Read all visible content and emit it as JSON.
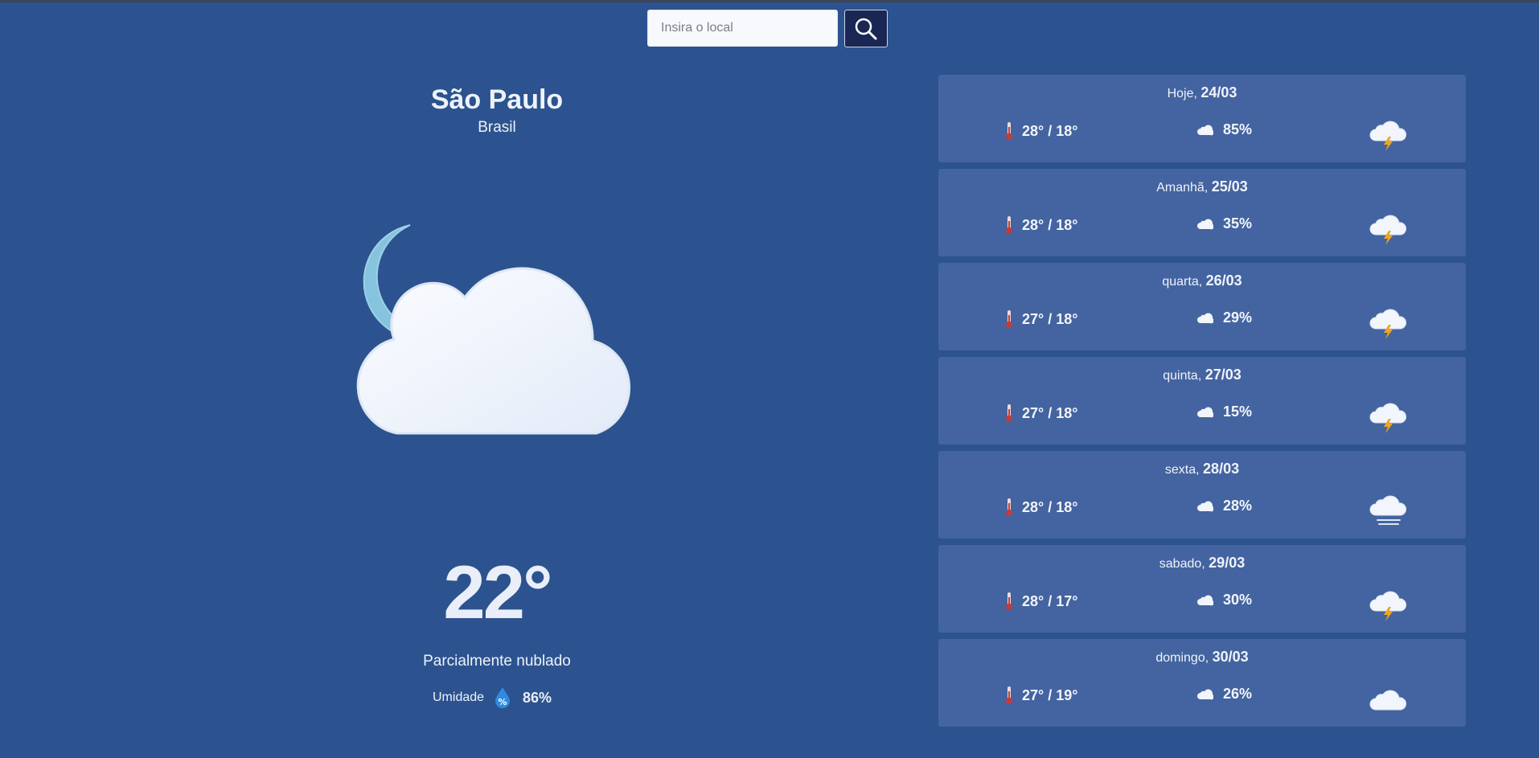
{
  "search": {
    "placeholder": "Insira o local",
    "value": "",
    "button_icon": "search-icon"
  },
  "current": {
    "city": "São Paulo",
    "country": "Brasil",
    "temperature": "22°",
    "description": "Parcialmente nublado",
    "humidity_label": "Umidade",
    "humidity_value": "86%",
    "icon": "partly-cloudy-night-icon"
  },
  "forecast": [
    {
      "label": "Hoje, ",
      "date": "24/03",
      "minmax": "28° / 18°",
      "rain": "85%",
      "icon": "thunderstorm-icon"
    },
    {
      "label": "Amanhã, ",
      "date": "25/03",
      "minmax": "28° / 18°",
      "rain": "35%",
      "icon": "thunderstorm-icon"
    },
    {
      "label": "quarta, ",
      "date": "26/03",
      "minmax": "27° / 18°",
      "rain": "29%",
      "icon": "thunderstorm-icon"
    },
    {
      "label": "quinta, ",
      "date": "27/03",
      "minmax": "27° / 18°",
      "rain": "15%",
      "icon": "thunderstorm-icon"
    },
    {
      "label": "sexta, ",
      "date": "28/03",
      "minmax": "28° / 18°",
      "rain": "28%",
      "icon": "fog-icon"
    },
    {
      "label": "sabado, ",
      "date": "29/03",
      "minmax": "28° / 17°",
      "rain": "30%",
      "icon": "thunderstorm-icon"
    },
    {
      "label": "domingo, ",
      "date": "30/03",
      "minmax": "27° / 19°",
      "rain": "26%",
      "icon": "cloud-icon"
    }
  ],
  "colors": {
    "background": "#2c538f",
    "card": "#4364a0",
    "search_button": "#1a2755",
    "text": "#e9eef8"
  }
}
